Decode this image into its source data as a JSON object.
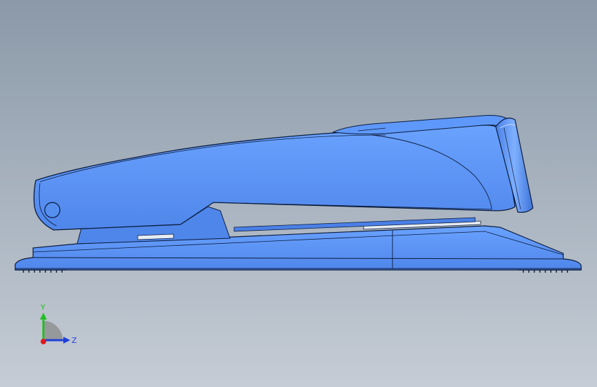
{
  "viewport": {
    "colors": {
      "background_top": "#8b99a8",
      "background_bottom": "#c5ccd5",
      "model_fill": "#5590f0",
      "model_edge": "#0a1a3a",
      "staple_strip": "#e6ecf5"
    }
  },
  "triad": {
    "y_label": "Y",
    "z_label": "Z",
    "colors": {
      "y_axis": "#22c022",
      "z_axis": "#1f3fd8",
      "x_axis": "#e01818"
    }
  }
}
